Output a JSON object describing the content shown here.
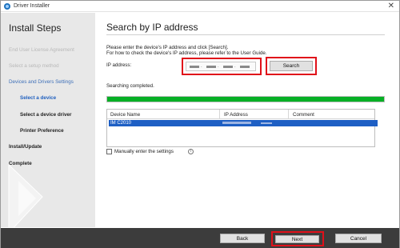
{
  "window": {
    "title": "Driver Installer",
    "close_glyph": "✕",
    "app_icon": "driver-installer-icon"
  },
  "sidebar": {
    "heading": "Install Steps",
    "steps": [
      {
        "label": "End User License Agreement",
        "state": "done"
      },
      {
        "label": "Select a setup method",
        "state": "done"
      },
      {
        "label": "Devices and Drivers Settings",
        "state": "section"
      },
      {
        "label": "Select a device",
        "state": "active"
      },
      {
        "label": "Select a device driver",
        "state": "pending"
      },
      {
        "label": "Printer Preference",
        "state": "pending"
      },
      {
        "label": "Install/Update",
        "state": "pending"
      },
      {
        "label": "Complete",
        "state": "pending"
      }
    ]
  },
  "main": {
    "title": "Search by IP address",
    "instruction_line1": "Please enter the device's IP address and click [Search].",
    "instruction_line2": "For how to check the device's IP address, please refer to the User Guide.",
    "ip_label": "IP address:",
    "search_label": "Search",
    "status_text": "Searching completed.",
    "progress_fraction": 1.0,
    "table": {
      "columns": [
        "Device Name",
        "IP Address",
        "Comment"
      ],
      "rows": [
        {
          "device_name": "IM C2010",
          "selected": true
        }
      ]
    },
    "manual_label": "Manually enter the settings",
    "manual_checked": false,
    "info_glyph": "i"
  },
  "footer": {
    "back_label": "Back",
    "next_label": "Next",
    "cancel_label": "Cancel"
  },
  "colors": {
    "highlight": "#e0101a",
    "progress": "#06b025",
    "selection": "#1e5fc4",
    "footer": "#3c3c3c",
    "sidebar": "#e8e8e8",
    "active_step": "#1f5fbf"
  }
}
